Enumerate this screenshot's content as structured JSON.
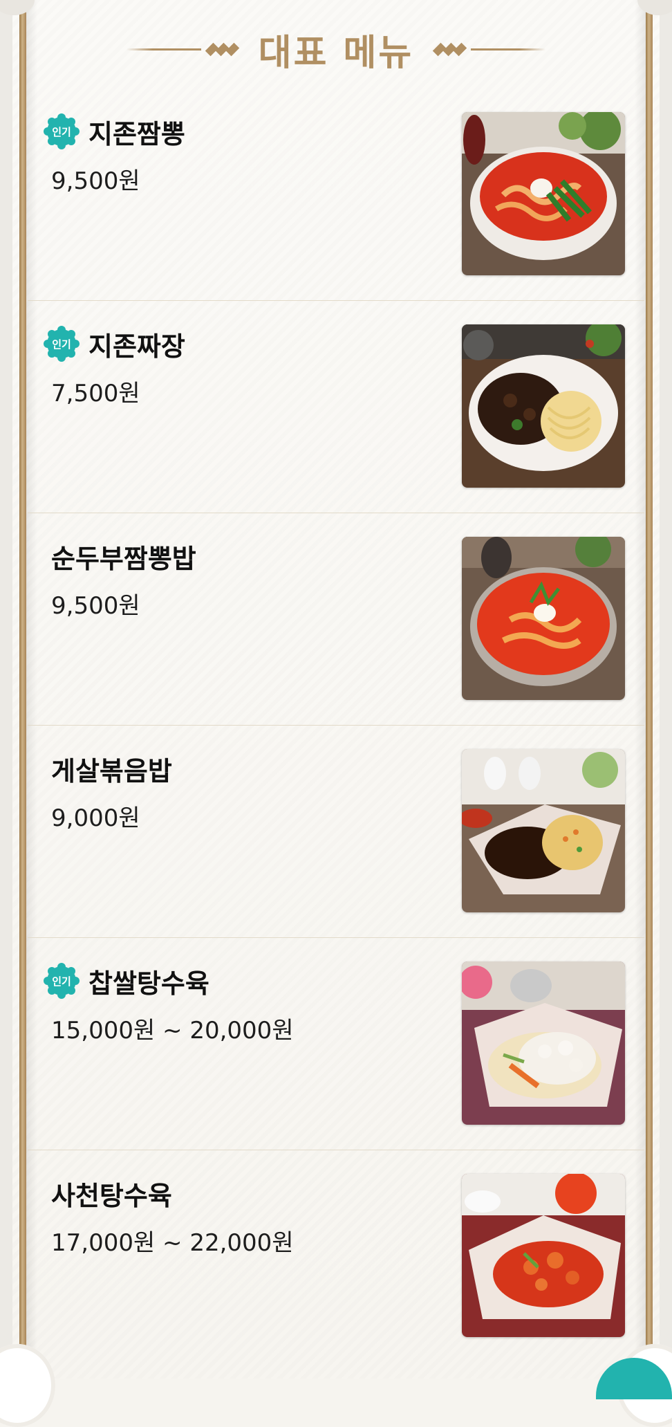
{
  "header": {
    "title": "대표 메뉴"
  },
  "menu": [
    {
      "name": "지존짬뽕",
      "price": "9,500원",
      "popular": true,
      "badge": "인기",
      "image_icon": "jjamppong-photo"
    },
    {
      "name": "지존짜장",
      "price": "7,500원",
      "popular": true,
      "badge": "인기",
      "image_icon": "jjajang-photo"
    },
    {
      "name": "순두부짬뽕밥",
      "price": "9,500원",
      "popular": false,
      "image_icon": "sundubu-jjamppong-bap-photo"
    },
    {
      "name": "게살볶음밥",
      "price": "9,000원",
      "popular": false,
      "image_icon": "crab-fried-rice-photo"
    },
    {
      "name": "찹쌀탕수육",
      "price": "15,000원 ~ 20,000원",
      "popular": true,
      "badge": "인기",
      "image_icon": "glutinous-sweet-sour-pork-photo"
    },
    {
      "name": "사천탕수육",
      "price": "17,000원 ~ 22,000원",
      "popular": false,
      "image_icon": "sichuan-sweet-sour-pork-photo"
    }
  ],
  "colors": {
    "gold": "#b08f62",
    "badge": "#22b3ae",
    "text": "#111111"
  }
}
